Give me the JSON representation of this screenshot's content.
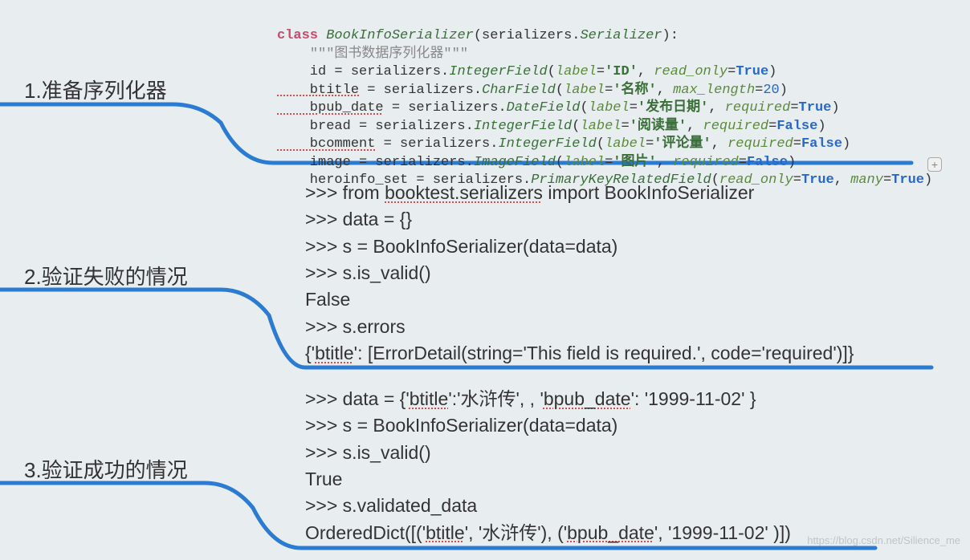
{
  "sections": {
    "s1": {
      "label": "1.准备序列化器"
    },
    "s2": {
      "label": "2.验证失败的情况"
    },
    "s3": {
      "label": "3.验证成功的情况"
    }
  },
  "code": {
    "class_kw": "class",
    "class_name": "BookInfoSerializer",
    "class_base_pre": "(serializers.",
    "class_base_fn": "Serializer",
    "class_base_post": "):",
    "docstring": "\"\"\"图书数据序列化器\"\"\"",
    "line_id_pre": "    id = serializers.",
    "integerfield": "IntegerField",
    "line_id_args": "(",
    "label_kw": "label",
    "eq": "=",
    "id_label": "'ID'",
    "readonly_kw": "read_only",
    "true": "True",
    "false": "False",
    "close": ")",
    "comma": ", ",
    "btitle_pre": "    btitle = serializers.",
    "charfield": "CharField",
    "btitle_label": "'名称'",
    "maxlen_kw": "max_length",
    "twenty": "20",
    "bpub_pre": "    bpub_date = serializers.",
    "datefield": "DateField",
    "bpub_label": "'发布日期'",
    "required_kw": "required",
    "bread_pre": "    bread = serializers.",
    "bread_label": "'阅读量'",
    "bcomment_pre": "    bcomment = serializers.",
    "bcomment_label": "'评论量'",
    "image_pre": "    image = serializers.",
    "imagefield": "ImageField",
    "image_label": "'图片'",
    "hero_pre": "    heroinfo_set = serializers.",
    "pkfield": "PrimaryKeyRelatedField",
    "many_kw": "many"
  },
  "console2": {
    "l1_pre": ">>> from ",
    "l1_pkg": "booktest.serializers",
    "l1_post": " import BookInfoSerializer",
    "l2": ">>> data = {}",
    "l3": ">>> s = BookInfoSerializer(data=data)",
    "l4": ">>> s.is_valid()",
    "l5": "False",
    "l6": ">>> s.errors",
    "l7_pre": "{'",
    "l7_key": "btitle",
    "l7_post": "': [ErrorDetail(string='This field is required.', code='required')]}"
  },
  "console3": {
    "l1_pre": ">>> data = {'",
    "l1_k1": "btitle",
    "l1_mid1": "':'水浒传', , '",
    "l1_k2": "bpub_date",
    "l1_mid2": "': '1999-11-02' }",
    "l2": ">>> s = BookInfoSerializer(data=data)",
    "l3": ">>> s.is_valid()",
    "l4": "True",
    "l5": ">>> s.validated_data",
    "l6_pre": "OrderedDict([('",
    "l6_k1": "btitle",
    "l6_mid1": "', '水浒传'), ('",
    "l6_k2": "bpub_date",
    "l6_mid2": "', '1999-11-02' )])"
  },
  "watermark": "https://blog.csdn.net/Silience_me",
  "plus_icon": "+"
}
